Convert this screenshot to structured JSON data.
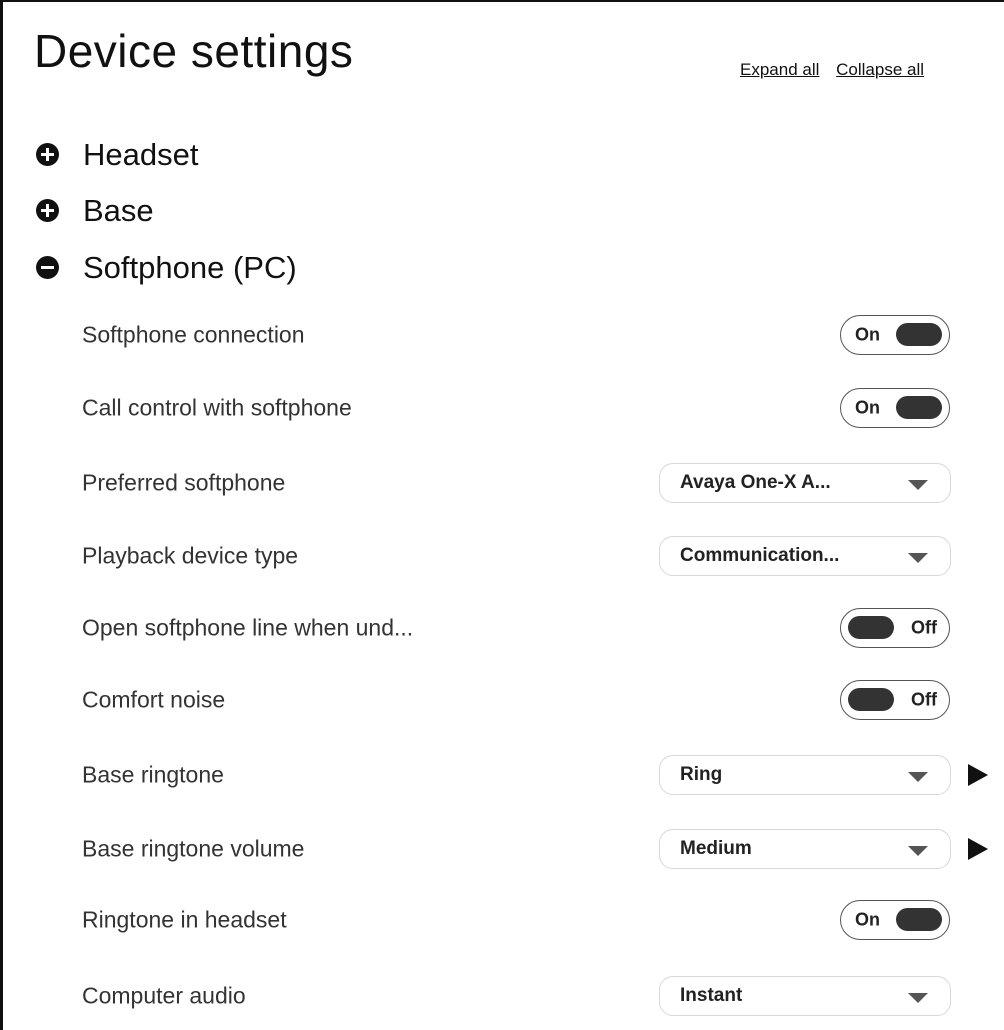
{
  "page": {
    "title": "Device settings",
    "expand_all": "Expand all",
    "collapse_all": "Collapse all"
  },
  "sections": [
    {
      "label": "Headset",
      "expanded": false,
      "icon": "plus-circle-icon"
    },
    {
      "label": "Base",
      "expanded": false,
      "icon": "plus-circle-icon"
    },
    {
      "label": "Softphone (PC)",
      "expanded": true,
      "icon": "minus-circle-icon"
    }
  ],
  "softphone_settings": [
    {
      "label": "Softphone connection",
      "control": "toggle",
      "value": "On"
    },
    {
      "label": "Call control with softphone",
      "control": "toggle",
      "value": "On"
    },
    {
      "label": "Preferred softphone",
      "control": "dropdown",
      "value": "Avaya One-X A..."
    },
    {
      "label": "Playback device type",
      "control": "dropdown",
      "value": "Communication..."
    },
    {
      "label": "Open softphone line when und...",
      "control": "toggle",
      "value": "Off"
    },
    {
      "label": "Comfort noise",
      "control": "toggle",
      "value": "Off"
    },
    {
      "label": "Base ringtone",
      "control": "dropdown",
      "value": "Ring",
      "play_button": true
    },
    {
      "label": "Base ringtone volume",
      "control": "dropdown",
      "value": "Medium",
      "play_button": true
    },
    {
      "label": "Ringtone in headset",
      "control": "toggle",
      "value": "On"
    },
    {
      "label": "Computer audio",
      "control": "dropdown",
      "value": "Instant"
    }
  ],
  "colors": {
    "text": "#111111",
    "row_label": "#333333",
    "toggle_knob": "#333333",
    "dropdown_border": "#d8d8d8"
  }
}
